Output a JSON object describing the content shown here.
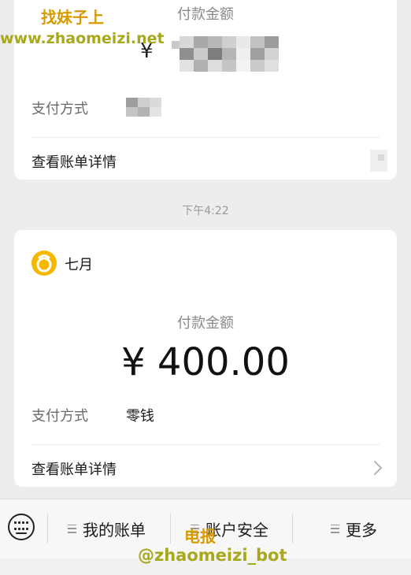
{
  "prev_card": {
    "amount_label": "付款金额",
    "currency_symbol": "¥",
    "pay_method_label": "支付方式",
    "detail_link": "查看账单详情"
  },
  "timestamp": "下午4:22",
  "payment_card": {
    "merchant_name": "七月",
    "merchant_icon": "circle-face-icon",
    "amount_label": "付款金额",
    "amount": "¥ 400.00",
    "pay_method_label": "支付方式",
    "pay_method_value": "零钱",
    "detail_link": "查看账单详情",
    "chevron_icon": "chevron-right-icon"
  },
  "bottom_bar": {
    "keyboard_icon": "keyboard-icon",
    "menu_items": [
      {
        "label": "我的账单"
      },
      {
        "label": "账户安全"
      },
      {
        "label": "更多"
      }
    ]
  },
  "watermark": {
    "site_name": "找妹子上",
    "site_url": "www.zhaomeizi.net",
    "tg_label": "电报",
    "tg_handle": "@zhaomeizi_bot"
  },
  "colors": {
    "background": "#ededed",
    "card": "#ffffff",
    "merchant_icon": "#f5b800",
    "watermark_orange": "#d89a00",
    "watermark_olive": "#a7a81a"
  }
}
